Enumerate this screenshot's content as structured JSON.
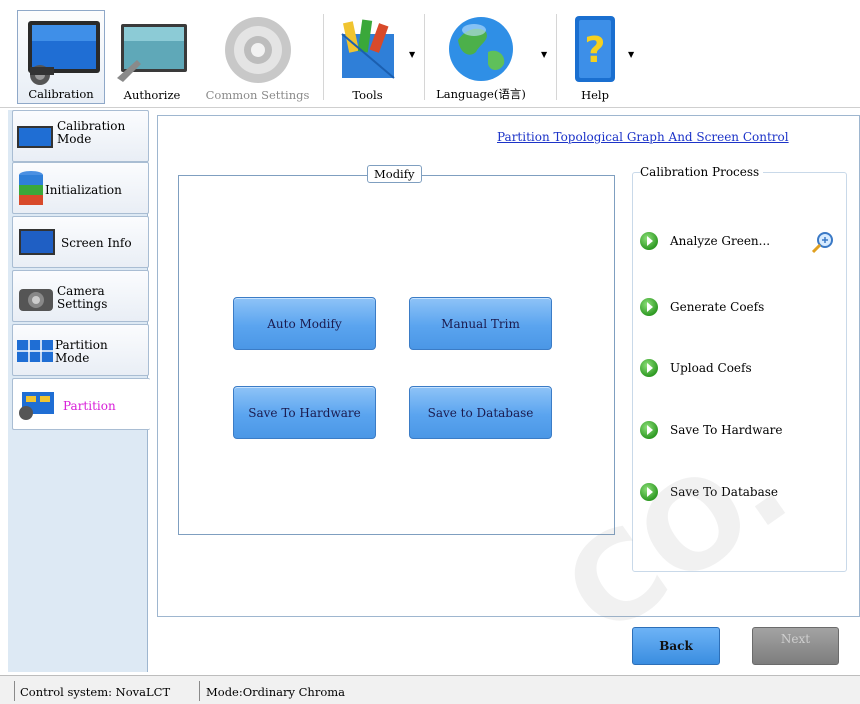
{
  "toolbar": {
    "items": [
      {
        "label": "Calibration",
        "icon": "calibration-monitor-icon"
      },
      {
        "label": "Authorize",
        "icon": "authorize-screen-icon"
      },
      {
        "label": "Common Settings",
        "icon": "gear-disc-icon"
      },
      {
        "label": "Tools",
        "icon": "tools-icon"
      },
      {
        "label": "Language(语言)",
        "icon": "globe-icon"
      },
      {
        "label": "Help",
        "icon": "help-book-icon"
      }
    ]
  },
  "nav": {
    "items": [
      {
        "label": "Calibration\nMode"
      },
      {
        "label": "Initialization"
      },
      {
        "label": "Screen Info"
      },
      {
        "label": "Camera\nSettings"
      },
      {
        "label": "Partition\nMode"
      },
      {
        "label": "Partition"
      }
    ]
  },
  "main": {
    "top_link": "Partition Topological Graph And Screen Control",
    "group_title": "Modify",
    "buttons": {
      "auto_modify": "Auto Modify",
      "manual_trim": "Manual Trim",
      "save_to_hardware": "Save To Hardware",
      "save_to_database": "Save to Database"
    },
    "process": {
      "title": "Calibration Process",
      "steps": [
        "Analyze Green...",
        "Generate Coefs",
        "Upload Coefs",
        "Save To Hardware",
        "Save To Database"
      ]
    },
    "back": "Back",
    "next": "Next"
  },
  "status": {
    "control": "Control system: NovaLCT",
    "mode": "Mode:Ordinary Chroma"
  },
  "colors": {
    "link": "#1c33c8",
    "active_nav": "#d81ed8",
    "button_blue": "#5aa4ef",
    "step_green": "#2f9a24"
  }
}
